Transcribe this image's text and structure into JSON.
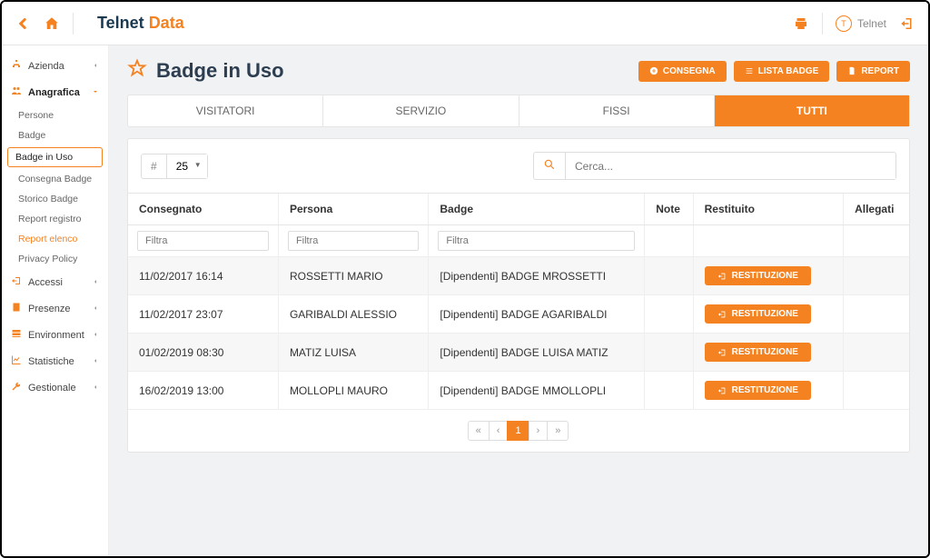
{
  "header": {
    "logo1": "Telnet",
    "logo2": "Data",
    "user": "Telnet",
    "user_initial": "T"
  },
  "sidebar": {
    "main": [
      {
        "label": "Azienda"
      },
      {
        "label": "Anagrafica"
      },
      {
        "label": "Accessi"
      },
      {
        "label": "Presenze"
      },
      {
        "label": "Environment"
      },
      {
        "label": "Statistiche"
      },
      {
        "label": "Gestionale"
      }
    ],
    "sub": [
      "Persone",
      "Badge",
      "Badge in Uso",
      "Consegna Badge",
      "Storico Badge",
      "Report registro",
      "Report elenco",
      "Privacy Policy"
    ]
  },
  "page": {
    "title": "Badge in Uso",
    "buttons": [
      "CONSEGNA",
      "LISTA BADGE",
      "REPORT"
    ]
  },
  "tabs": [
    "VISITATORI",
    "SERVIZIO",
    "FISSI",
    "TUTTI"
  ],
  "toolbar": {
    "hash": "#",
    "page_size": "25",
    "search_placeholder": "Cerca..."
  },
  "table": {
    "columns": [
      "Consegnato",
      "Persona",
      "Badge",
      "Note",
      "Restituito",
      "Allegati"
    ],
    "filter_placeholder": "Filtra",
    "restituzione_label": "RESTITUZIONE",
    "rows": [
      {
        "consegnato": "11/02/2017 16:14",
        "persona": "ROSSETTI MARIO",
        "badge": "[Dipendenti] BADGE MROSSETTI"
      },
      {
        "consegnato": "11/02/2017 23:07",
        "persona": "GARIBALDI ALESSIO",
        "badge": "[Dipendenti] BADGE AGARIBALDI"
      },
      {
        "consegnato": "01/02/2019 08:30",
        "persona": "MATIZ LUISA",
        "badge": "[Dipendenti] BADGE LUISA MATIZ"
      },
      {
        "consegnato": "16/02/2019 13:00",
        "persona": "MOLLOPLI MAURO",
        "badge": "[Dipendenti] BADGE MMOLLOPLI"
      }
    ]
  },
  "pagination": {
    "first": "«",
    "prev": "‹",
    "current": "1",
    "next": "›",
    "last": "»"
  }
}
